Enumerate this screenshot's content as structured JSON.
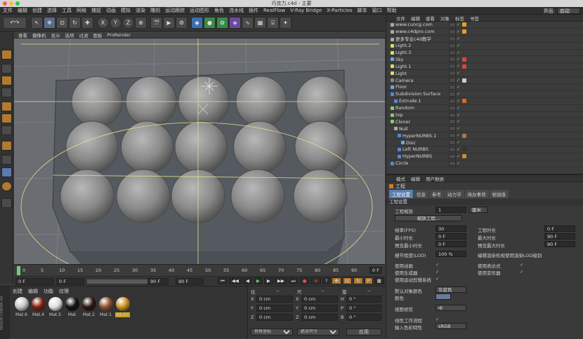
{
  "window": {
    "title": "巧克力.c4d - 主要"
  },
  "menubar": {
    "items": [
      "文件",
      "编辑",
      "创建",
      "选择",
      "工具",
      "网格",
      "捕捉",
      "动画",
      "模拟",
      "渲染",
      "雕刻",
      "运动跟踪",
      "运动图形",
      "角色",
      "流水线",
      "插件",
      "RealFlow",
      "V-Ray Bridge",
      "X-Particles",
      "脚本",
      "窗口",
      "帮助"
    ],
    "layout_label": "界面:",
    "layout_value": "启动"
  },
  "viewport": {
    "menu": [
      "查看",
      "摄像机",
      "显示",
      "选项",
      "过滤",
      "面板",
      "ProRender"
    ],
    "background_color": "#6a6d72"
  },
  "timeline": {
    "ticks": [
      "0",
      "5",
      "10",
      "15",
      "20",
      "25",
      "30",
      "35",
      "40",
      "45",
      "50",
      "55",
      "60",
      "65",
      "70",
      "75",
      "80",
      "85",
      "90"
    ],
    "end_frame": "0 F"
  },
  "transport": {
    "current": "0 F",
    "start": "0 F",
    "preview_end": "90 F",
    "end": "90 F"
  },
  "materials": {
    "menu": [
      "创建",
      "编辑",
      "功能",
      "纹理"
    ],
    "brand": "MAXON CINEMA 4D",
    "items": [
      {
        "name": "Mat.6",
        "color": "#c8c8c8"
      },
      {
        "name": "Mat.4",
        "color": "#7a2010"
      },
      {
        "name": "Mat.5",
        "color": "#e0e0e0"
      },
      {
        "name": "Mat",
        "color": "#111111"
      },
      {
        "name": "Mat.2",
        "color": "#2a1510"
      },
      {
        "name": "Mat.1",
        "color": "#8a5030"
      },
      {
        "name": "AS-07",
        "color": "#c89020"
      }
    ]
  },
  "coords": {
    "header": [
      "位",
      "--",
      "尺",
      "--",
      "旋",
      "--"
    ],
    "rows": [
      {
        "axis": "X",
        "pos": "0 cm",
        "size": "0 cm",
        "rot_label": "H",
        "rot": "0 °"
      },
      {
        "axis": "Y",
        "pos": "0 cm",
        "size": "0 cm",
        "rot_label": "P",
        "rot": "0 °"
      },
      {
        "axis": "Z",
        "pos": "0 cm",
        "size": "0 cm",
        "rot_label": "B",
        "rot": "0 °"
      }
    ],
    "mode": "世界坐标",
    "scale_mode": "绝对尺寸",
    "apply": "应用"
  },
  "objects": {
    "menu": [
      "文件",
      "编辑",
      "查看",
      "对象",
      "标签",
      "书签"
    ],
    "rows": [
      {
        "name": "www.cuncg.com",
        "indent": 0,
        "icon_color": "#aaaaaa",
        "tag": "#e8a020"
      },
      {
        "name": "www.c4dpro.com",
        "indent": 0,
        "icon_color": "#aaaaaa",
        "tag": "#e8a020"
      },
      {
        "name": "更多专业c4d教学",
        "indent": 0,
        "icon_color": "#aaaaaa",
        "tag": ""
      },
      {
        "name": "Light.2",
        "indent": 0,
        "icon_color": "#dddd66",
        "tag": ""
      },
      {
        "name": "Light.3",
        "indent": 0,
        "icon_color": "#dddd66",
        "tag": ""
      },
      {
        "name": "Sky",
        "indent": 0,
        "icon_color": "#66aadd",
        "tag": "#dd4444"
      },
      {
        "name": "Light.1",
        "indent": 0,
        "icon_color": "#dddd66",
        "tag": "#dd4444"
      },
      {
        "name": "Light",
        "indent": 0,
        "icon_color": "#dddd66",
        "tag": ""
      },
      {
        "name": "Camera",
        "indent": 0,
        "icon_color": "#888888",
        "tag": "#cccccc"
      },
      {
        "name": "Floor",
        "indent": 0,
        "icon_color": "#66aadd",
        "tag": ""
      },
      {
        "name": "Subdivision Surface",
        "indent": 0,
        "icon_color": "#5588dd",
        "tag": ""
      },
      {
        "name": "Extrude.1",
        "indent": 1,
        "icon_color": "#5588dd",
        "tag": "#dd6622"
      },
      {
        "name": "Random",
        "indent": 0,
        "icon_color": "#88cc66",
        "tag": ""
      },
      {
        "name": "top",
        "indent": 0,
        "icon_color": "#88cc66",
        "tag": ""
      },
      {
        "name": "Cloner",
        "indent": 0,
        "icon_color": "#88cc66",
        "tag": ""
      },
      {
        "name": "Null",
        "indent": 1,
        "icon_color": "#aaaaaa",
        "tag": ""
      },
      {
        "name": "HyperNURBS.1",
        "indent": 2,
        "icon_color": "#5588dd",
        "tag": "#aa7755"
      },
      {
        "name": "Disc",
        "indent": 3,
        "icon_color": "#66aadd",
        "tag": ""
      },
      {
        "name": "Loft NURBS",
        "indent": 2,
        "icon_color": "#5588dd",
        "tag": "#333333"
      },
      {
        "name": "HyperNURBS",
        "indent": 2,
        "icon_color": "#5588dd",
        "tag": "#c89020"
      },
      {
        "name": "Circle",
        "indent": 0,
        "icon_color": "#5588dd",
        "tag": ""
      }
    ]
  },
  "attributes": {
    "menu": [
      "模式",
      "编辑",
      "用户数据"
    ],
    "title": "工程",
    "tabs": [
      "工程设置",
      "信息",
      "参考",
      "动力学",
      "待办事项",
      "帧插值"
    ],
    "section": "工程设置",
    "fields": {
      "scale_label": "工程缩放",
      "scale_value": "1",
      "scale_unit": "厘米",
      "scale_btn": "缩放工程...",
      "fps_label": "帧率(FPS)",
      "fps_value": "30",
      "duration_label": "工程时长",
      "duration_value": "0 F",
      "min_label": "最小时长",
      "min_value": "0 F",
      "max_label": "最大时长",
      "max_value": "90 F",
      "pmin_label": "预览最小时长",
      "pmin_value": "0 F",
      "pmax_label": "预览最大时长",
      "pmax_value": "90 F",
      "lod_label": "细节程度(LOD)",
      "lod_value": "100 %",
      "lod_render_label": "编辑渲染检视使用渲染LOD级别",
      "anim_label": "使用动画",
      "expr_label": "使用表达式",
      "gen_label": "使用生成器",
      "deform_label": "使用变形器",
      "motion_label": "使用运动剪辑系统",
      "default_color_label": "默认对象颜色",
      "default_color_value": "灰蓝色",
      "color_label": "颜色",
      "view_clip_label": "视图修剪",
      "view_clip_value": "中",
      "linear_label": "线性工作流程",
      "input_color_label": "输入色彩特性",
      "input_color_value": "sRGB"
    }
  }
}
